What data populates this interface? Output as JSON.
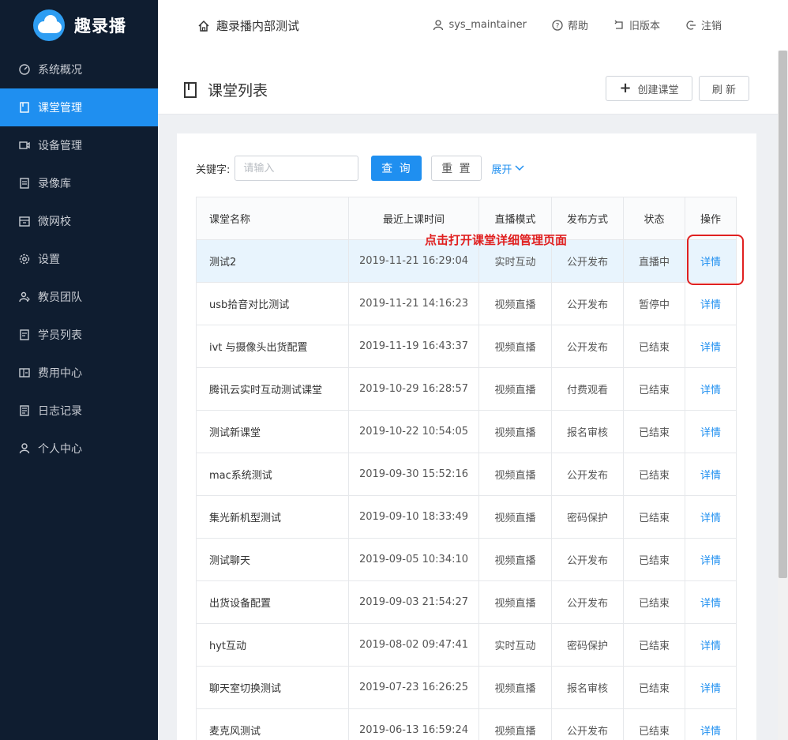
{
  "brand": {
    "name": "趣录播"
  },
  "sidebar": {
    "items": [
      {
        "label": "系统概况",
        "icon": "dashboard-icon",
        "active": false
      },
      {
        "label": "课堂管理",
        "icon": "book-icon",
        "active": true
      },
      {
        "label": "设备管理",
        "icon": "camera-icon",
        "active": false
      },
      {
        "label": "录像库",
        "icon": "library-icon",
        "active": false
      },
      {
        "label": "微网校",
        "icon": "school-icon",
        "active": false
      },
      {
        "label": "设置",
        "icon": "gear-icon",
        "active": false
      },
      {
        "label": "教员团队",
        "icon": "team-icon",
        "active": false
      },
      {
        "label": "学员列表",
        "icon": "list-icon",
        "active": false
      },
      {
        "label": "费用中心",
        "icon": "billing-icon",
        "active": false
      },
      {
        "label": "日志记录",
        "icon": "log-icon",
        "active": false
      },
      {
        "label": "个人中心",
        "icon": "user-icon",
        "active": false
      }
    ]
  },
  "header": {
    "title": "趣录播内部测试",
    "user": "sys_maintainer",
    "help": "帮助",
    "old_version": "旧版本",
    "logout": "注销"
  },
  "page": {
    "title": "课堂列表",
    "create_label": "创建课堂",
    "refresh_label": "刷 新"
  },
  "filter": {
    "keyword_label": "关键字:",
    "keyword_placeholder": "请输入",
    "keyword_value": "",
    "query_label": "查 询",
    "reset_label": "重 置",
    "expand_label": "展开"
  },
  "table": {
    "columns": [
      "课堂名称",
      "最近上课时间",
      "直播模式",
      "发布方式",
      "状态",
      "操作"
    ],
    "rows": [
      {
        "name": "测试2",
        "time": "2019-11-21 16:29:04",
        "mode": "实时互动",
        "publish": "公开发布",
        "status": "直播中",
        "action": "详情"
      },
      {
        "name": "usb拾音对比测试",
        "time": "2019-11-21 14:16:23",
        "mode": "视频直播",
        "publish": "公开发布",
        "status": "暂停中",
        "action": "详情"
      },
      {
        "name": "ivt 与摄像头出货配置",
        "time": "2019-11-19 16:43:37",
        "mode": "视频直播",
        "publish": "公开发布",
        "status": "已结束",
        "action": "详情"
      },
      {
        "name": "腾讯云实时互动测试课堂",
        "time": "2019-10-29 16:28:57",
        "mode": "视频直播",
        "publish": "付费观看",
        "status": "已结束",
        "action": "详情"
      },
      {
        "name": "测试新课堂",
        "time": "2019-10-22 10:54:05",
        "mode": "视频直播",
        "publish": "报名审核",
        "status": "已结束",
        "action": "详情"
      },
      {
        "name": "mac系统测试",
        "time": "2019-09-30 15:52:16",
        "mode": "视频直播",
        "publish": "公开发布",
        "status": "已结束",
        "action": "详情"
      },
      {
        "name": "集光新机型测试",
        "time": "2019-09-10 18:33:49",
        "mode": "视频直播",
        "publish": "密码保护",
        "status": "已结束",
        "action": "详情"
      },
      {
        "name": "测试聊天",
        "time": "2019-09-05 10:34:10",
        "mode": "视频直播",
        "publish": "公开发布",
        "status": "已结束",
        "action": "详情"
      },
      {
        "name": "出货设备配置",
        "time": "2019-09-03 21:54:27",
        "mode": "视频直播",
        "publish": "公开发布",
        "status": "已结束",
        "action": "详情"
      },
      {
        "name": "hyt互动",
        "time": "2019-08-02 09:47:41",
        "mode": "实时互动",
        "publish": "密码保护",
        "status": "已结束",
        "action": "详情"
      },
      {
        "name": "聊天室切换测试",
        "time": "2019-07-23 16:26:25",
        "mode": "视频直播",
        "publish": "报名审核",
        "status": "已结束",
        "action": "详情"
      },
      {
        "name": "麦克风测试",
        "time": "2019-06-13 16:59:24",
        "mode": "视频直播",
        "publish": "公开发布",
        "status": "已结束",
        "action": "详情"
      }
    ]
  },
  "annotation": {
    "text": "点击打开课堂详细管理页面"
  },
  "colors": {
    "sidebar_bg": "#0f1d30",
    "accent": "#1f8ff0",
    "annotation": "#e02020"
  }
}
